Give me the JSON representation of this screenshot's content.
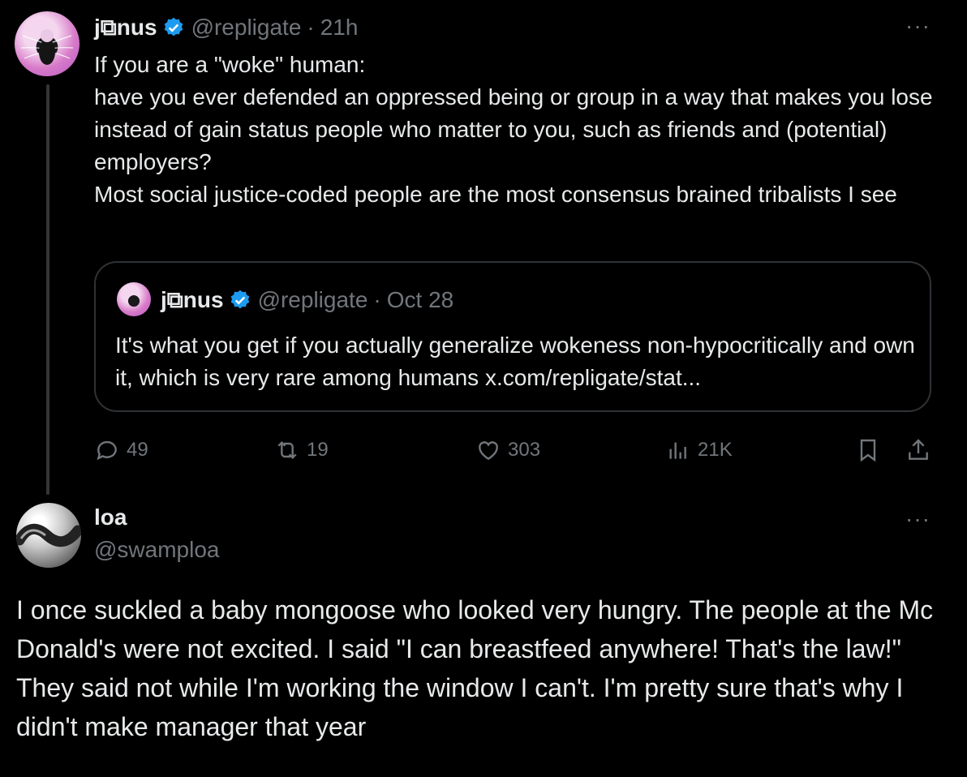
{
  "post": {
    "author_name": "j⧉nus",
    "author_handle": "@repligate",
    "time": "21h",
    "more": "···",
    "text": "If you are a \"woke\" human:\nhave you ever defended an oppressed being or group in a way that makes you lose instead of gain status people who matter to you, such as friends and (potential) employers?\nMost social justice-coded people are the most consensus brained tribalists I see",
    "quote": {
      "author_name": "j⧉nus",
      "author_handle": "@repligate",
      "time": "Oct 28",
      "text": "It's what you get if you actually generalize wokeness non-hypocritically and own it, which is very rare among humans x.com/repligate/stat..."
    },
    "actions": {
      "replies": "49",
      "reposts": "19",
      "likes": "303",
      "views": "21K"
    }
  },
  "reply": {
    "author_name": "loa",
    "author_handle": "@swamploa",
    "more": "···",
    "text": "I once suckled a baby mongoose who looked very hungry. The people at the Mc Donald's were not excited. I said \"I can breastfeed anywhere! That's the law!\" They said not while I'm working the window I can't. I'm pretty sure that's why I didn't make manager that year"
  },
  "colors": {
    "background": "#000000",
    "text": "#e7e9ea",
    "muted": "#71767b",
    "verified": "#1d9bf0",
    "border": "#2f3336"
  },
  "icons": [
    "verified-badge-icon",
    "more-icon",
    "reply-icon",
    "repost-icon",
    "like-icon",
    "views-icon",
    "bookmark-icon",
    "share-icon"
  ]
}
